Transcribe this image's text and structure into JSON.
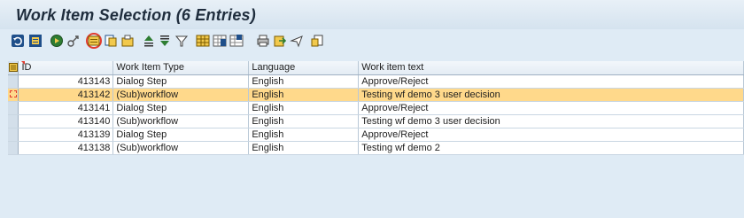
{
  "window": {
    "title": "Work Item Selection (6 Entries)"
  },
  "toolbar": {
    "buttons": [
      {
        "icon": "refresh-icon"
      },
      {
        "icon": "display-icon"
      },
      {
        "icon": "execute-icon"
      },
      {
        "icon": "workflow-log-icon"
      },
      {
        "icon": "display-workitem-icon"
      },
      {
        "icon": "details-icon"
      },
      {
        "icon": "technical-icon"
      },
      {
        "icon": "sort-ascending-icon"
      },
      {
        "icon": "sort-descending-icon"
      },
      {
        "icon": "filter-icon"
      },
      {
        "icon": "layout-icon"
      },
      {
        "icon": "change-layout-icon"
      },
      {
        "icon": "save-layout-icon"
      },
      {
        "icon": "print-icon"
      },
      {
        "icon": "export-icon"
      },
      {
        "icon": "send-icon"
      },
      {
        "icon": "local-file-icon"
      }
    ],
    "highlight_color": "#e23b2e"
  },
  "grid": {
    "columns": {
      "id": "ID",
      "type": "Work Item Type",
      "language": "Language",
      "text": "Work item text"
    },
    "rows": [
      {
        "id": "413143",
        "type": "Dialog Step",
        "language": "English",
        "text": "Approve/Reject"
      },
      {
        "id": "413142",
        "type": "(Sub)workflow",
        "language": "English",
        "text": "Testing wf demo 3 user decision"
      },
      {
        "id": "413141",
        "type": "Dialog Step",
        "language": "English",
        "text": "Approve/Reject"
      },
      {
        "id": "413140",
        "type": "(Sub)workflow",
        "language": "English",
        "text": "Testing wf demo 3 user decision"
      },
      {
        "id": "413139",
        "type": "Dialog Step",
        "language": "English",
        "text": "Approve/Reject"
      },
      {
        "id": "413138",
        "type": "(Sub)workflow",
        "language": "English",
        "text": "Testing wf demo 2"
      }
    ],
    "selected_row_color": "#ffd98b"
  }
}
